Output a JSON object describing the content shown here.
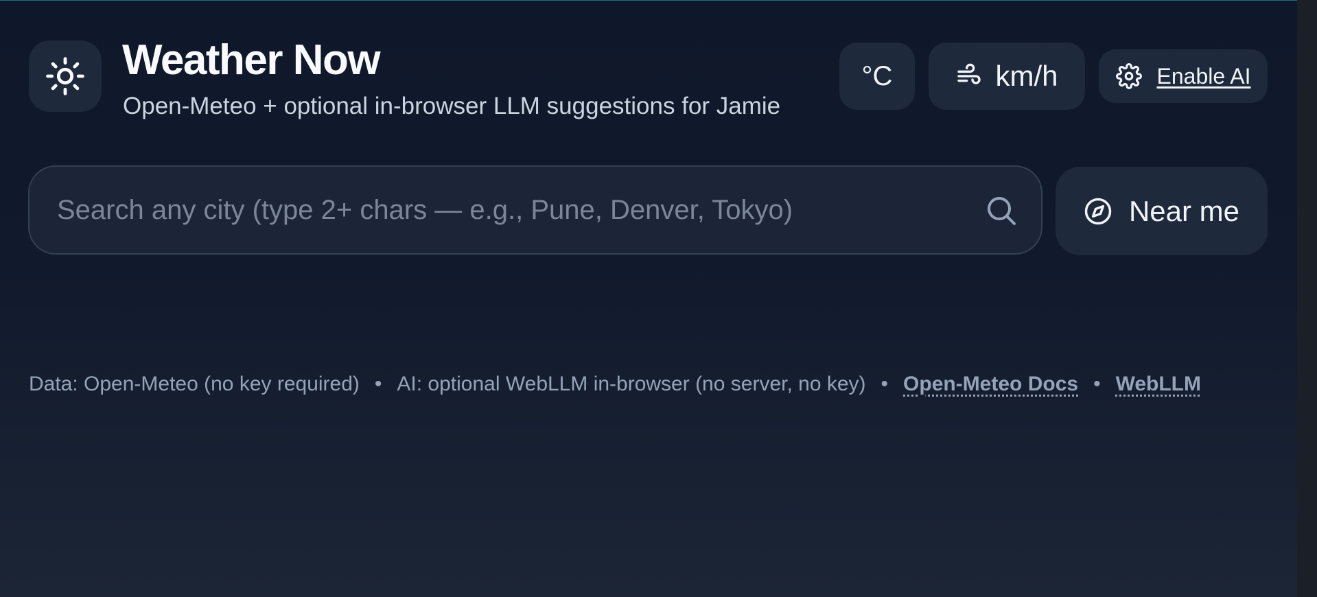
{
  "header": {
    "logo_icon": "sun-icon",
    "title": "Weather Now",
    "subtitle": "Open-Meteo + optional in-browser LLM suggestions for Jamie"
  },
  "controls": {
    "temp_unit_label": "°C",
    "wind_unit_icon": "wind-icon",
    "wind_unit_label": "km/h",
    "ai_icon": "gear-icon",
    "ai_label": "Enable AI"
  },
  "search": {
    "placeholder": "Search any city (type 2+ chars — e.g., Pune, Denver, Tokyo)",
    "value": "",
    "icon": "search-icon"
  },
  "near_me": {
    "icon": "compass-icon",
    "label": "Near me"
  },
  "footer": {
    "data_note": "Data: Open-Meteo (no key required)",
    "ai_note": "AI: optional WebLLM in-browser (no server, no key)",
    "separator": "•",
    "links": [
      {
        "label": "Open-Meteo Docs"
      },
      {
        "label": "WebLLM"
      }
    ]
  },
  "colors": {
    "background": "#0f172a",
    "card": "#1e293b",
    "text": "#f1f5f9",
    "muted": "#94a3b8",
    "accent_line": "#1f6f8b"
  }
}
